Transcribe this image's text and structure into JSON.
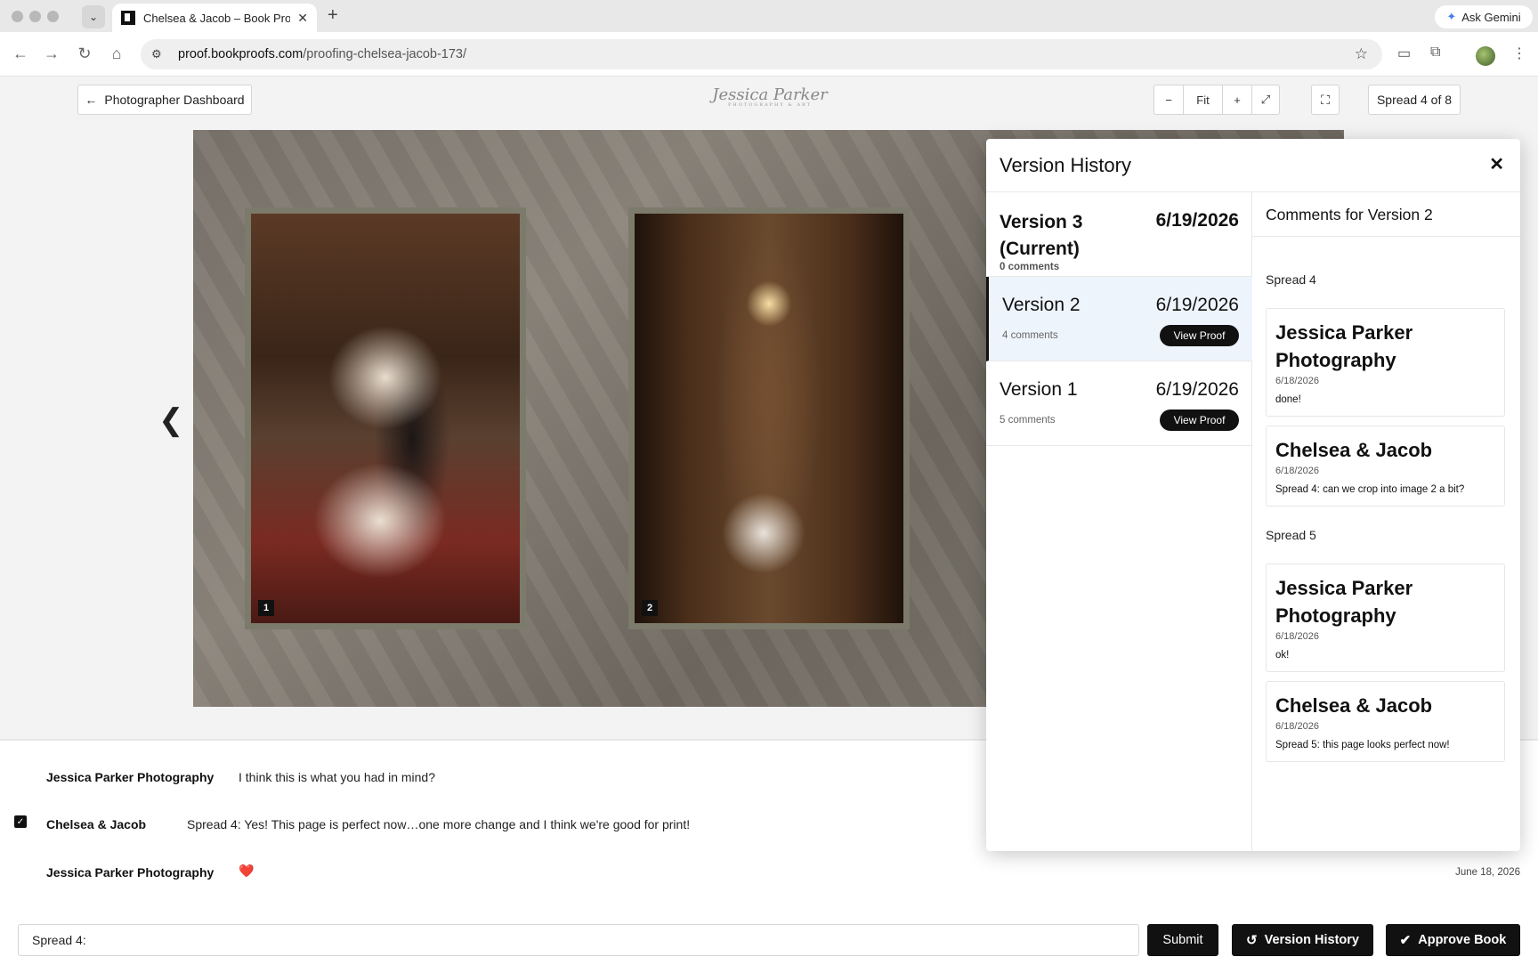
{
  "browser": {
    "tab_title": "Chelsea & Jacob – Book Proo",
    "tab_close": "✕",
    "new_tab": "+",
    "ask_gemini": "Ask Gemini",
    "url_host": "proof.bookproofs.com",
    "url_path": "/proofing-chelsea-jacob-173/"
  },
  "header": {
    "back_label": "Photographer Dashboard",
    "logo_text": "Jessica Parker",
    "logo_sub": "PHOTOGRAPHY & ART",
    "zoom_out": "−",
    "zoom_fit": "Fit",
    "zoom_in": "+",
    "zoom_reset": "⤢",
    "fullscreen": "⛶",
    "spread_indicator": "Spread 4 of 8"
  },
  "spread": {
    "photos": [
      {
        "number": "1"
      },
      {
        "number": "2"
      }
    ],
    "prev_arrow": "❮"
  },
  "comments": [
    {
      "author": "Jessica Parker Photography",
      "text": "I think this is what you had in mind?",
      "checked": false
    },
    {
      "author": "Chelsea & Jacob",
      "text": "Spread 4: Yes! This page is perfect now…one more change and I think we're good for print!",
      "checked": true
    },
    {
      "author": "Jessica Parker Photography",
      "text": "❤️",
      "date": "June 18, 2026"
    }
  ],
  "composer": {
    "value": "Spread 4:",
    "submit": "Submit",
    "version_history": "Version History",
    "approve": "Approve Book"
  },
  "version_history": {
    "title": "Version History",
    "close": "✕",
    "versions": [
      {
        "name": "Version 3 (Current)",
        "name_line1": "Version 3",
        "name_line2": "(Current)",
        "date": "6/19/2026",
        "comments": "0 comments"
      },
      {
        "name": "Version 2",
        "date": "6/19/2026",
        "comments": "4 comments",
        "button": "View Proof"
      },
      {
        "name": "Version 1",
        "date": "6/19/2026",
        "comments": "5 comments",
        "button": "View Proof"
      }
    ],
    "comments_title": "Comments for Version 2",
    "groups": [
      {
        "spread": "Spread 4",
        "items": [
          {
            "author": "Jessica Parker Photography",
            "date": "6/18/2026",
            "text": "done!"
          },
          {
            "author": "Chelsea & Jacob",
            "date": "6/18/2026",
            "text": "Spread 4: can we crop into image 2 a bit?"
          }
        ]
      },
      {
        "spread": "Spread 5",
        "items": [
          {
            "author": "Jessica Parker Photography",
            "date": "6/18/2026",
            "text": "ok!"
          },
          {
            "author": "Chelsea & Jacob",
            "date": "6/18/2026",
            "text": "Spread 5: this page looks perfect now!"
          }
        ]
      }
    ]
  }
}
